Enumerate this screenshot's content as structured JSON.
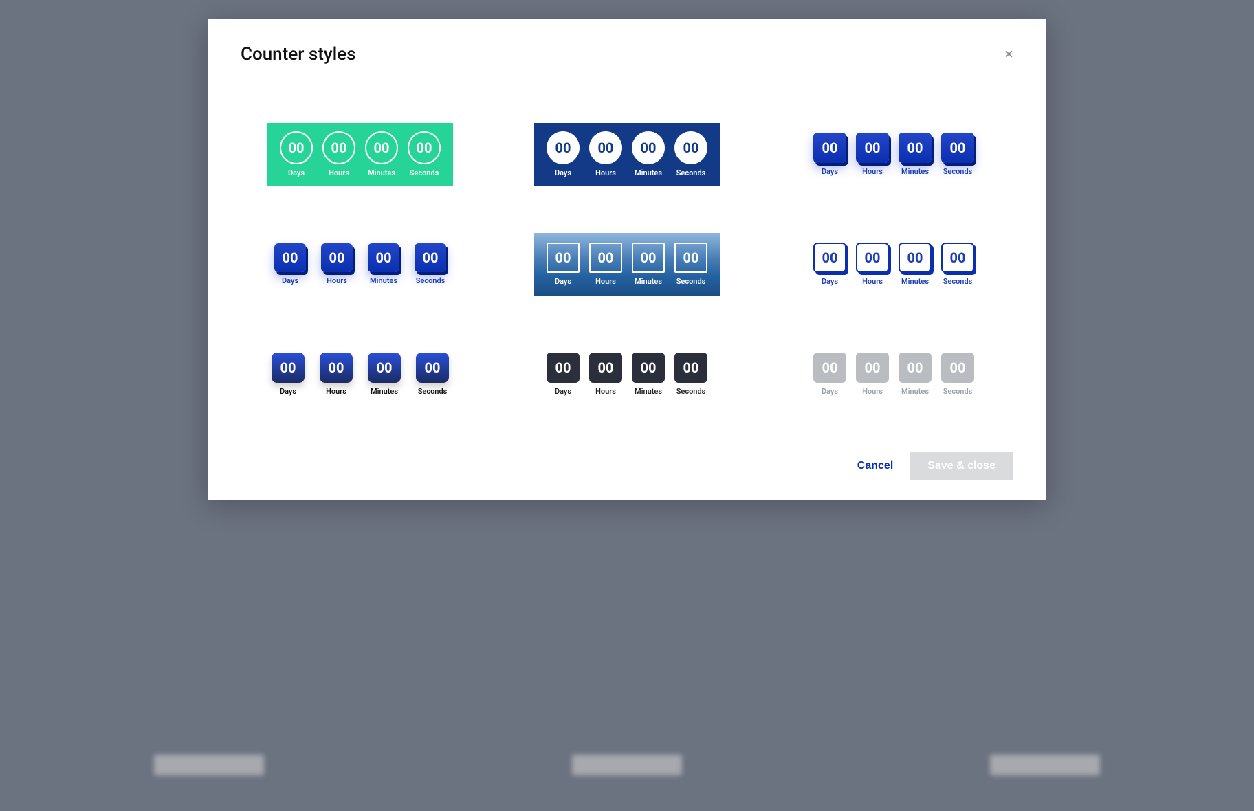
{
  "modal": {
    "title": "Counter styles",
    "close_glyph": "×"
  },
  "units": {
    "days": {
      "value": "00",
      "label": "Days"
    },
    "hours": {
      "value": "00",
      "label": "Hours"
    },
    "minutes": {
      "value": "00",
      "label": "Minutes"
    },
    "seconds": {
      "value": "00",
      "label": "Seconds"
    }
  },
  "footer": {
    "cancel_label": "Cancel",
    "save_label": "Save & close"
  }
}
